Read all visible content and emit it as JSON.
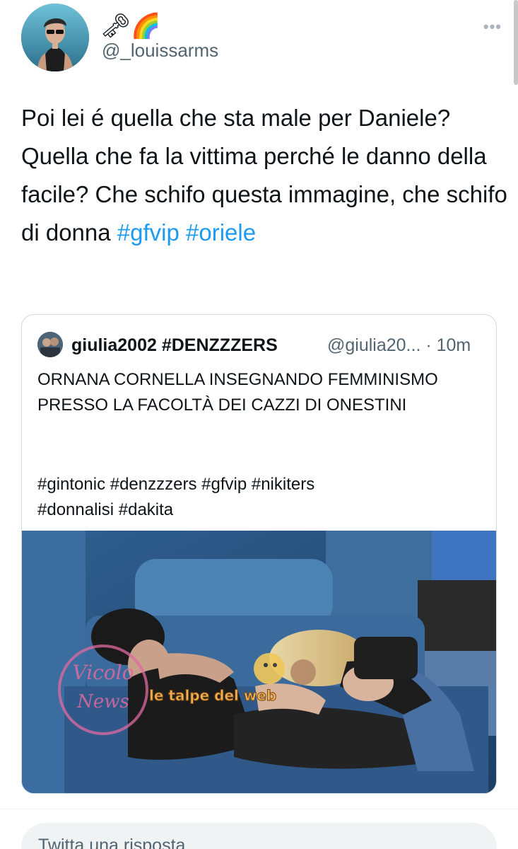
{
  "author": {
    "display_name": "🗝🌈",
    "handle": "@_louissarms"
  },
  "tweet": {
    "text_before": "Poi lei é quella che sta male per Daniele? Quella che fa la vittima perché le danno della facile? Che schifo questa immagine, che schifo di donna ",
    "hashtags": [
      "#gfvip",
      "#oriele"
    ]
  },
  "quoted": {
    "name": "giulia2002 #DENZZZERS",
    "handle_time": "@giulia20... · 10m",
    "text": "ORNANA CORNELLA INSEGNANDO FEMMINISMO PRESSO LA FACOLTÀ DEI CAZZI DI ONESTINI",
    "tags_line1": "#gintonic #denzzzers #gfvip #nikiters",
    "tags_line2": "#donnalisi #dakita",
    "media": {
      "watermark_left": "Vicolo delle News",
      "watermark_center": "le talpe del web"
    }
  },
  "reply": {
    "placeholder": "Twitta una risposta"
  },
  "icons": {
    "more": "more-horizontal-icon"
  },
  "colors": {
    "link": "#1d9bf0",
    "secondary_text": "#536471",
    "border": "#cfd9de"
  }
}
